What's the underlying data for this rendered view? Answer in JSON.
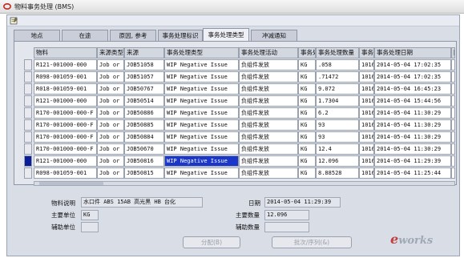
{
  "window": {
    "title": "物料事务处理 (BMS)"
  },
  "tabs": [
    {
      "label": "地点",
      "active": false
    },
    {
      "label": "在途",
      "active": false
    },
    {
      "label": "原因, 参考",
      "active": false
    },
    {
      "label": "事务处理标识",
      "active": false
    },
    {
      "label": "事务处理类型",
      "active": true
    },
    {
      "label": "冲减通知",
      "active": false
    }
  ],
  "table": {
    "headers": [
      "物料",
      "来源类型",
      "来源",
      "事务处理类型",
      "事务处理活动",
      "事务处",
      "事务处理数量",
      "事务处",
      "事务处理日期",
      "["
    ],
    "rows": [
      [
        "R121-001000-000",
        "Job or",
        "JOB51058",
        "WIP Negative Issue",
        "负组件发放",
        "KG",
        ".058",
        "1016",
        "2014-05-04 17:02:35",
        ""
      ],
      [
        "R098-001059-001",
        "Job or",
        "JOB51057",
        "WIP Negative Issue",
        "负组件发放",
        "KG",
        ".71472",
        "1016",
        "2014-05-04 17:02:35",
        ""
      ],
      [
        "R018-001059-001",
        "Job or",
        "JOB50767",
        "WIP Negative Issue",
        "负组件发放",
        "KG",
        "9.072",
        "1016",
        "2014-05-04 16:45:23",
        ""
      ],
      [
        "R121-001000-000",
        "Job or",
        "JOB50514",
        "WIP Negative Issue",
        "负组件发放",
        "KG",
        "1.7304",
        "1016",
        "2014-05-04 15:44:56",
        ""
      ],
      [
        "R170-001000-000-F",
        "Job or",
        "JOB50886",
        "WIP Negative Issue",
        "负组件发放",
        "KG",
        "6.2",
        "1016",
        "2014-05-04 11:30:29",
        ""
      ],
      [
        "R170-001000-000-F",
        "Job or",
        "JOB50885",
        "WIP Negative Issue",
        "负组件发放",
        "KG",
        "93",
        "1016",
        "2014-05-04 11:30:29",
        ""
      ],
      [
        "R170-001000-000-F",
        "Job or",
        "JOB50884",
        "WIP Negative Issue",
        "负组件发放",
        "KG",
        "93",
        "1016",
        "2014-05-04 11:30:29",
        ""
      ],
      [
        "R170-001000-000-F",
        "Job or",
        "JOB50670",
        "WIP Negative Issue",
        "负组件发放",
        "KG",
        "12.4",
        "1016",
        "2014-05-04 11:30:29",
        ""
      ],
      [
        "R121-001000-000",
        "Job or",
        "JOB50816",
        "WIP Negative Issue",
        "负组件发放",
        "KG",
        "12.096",
        "1016",
        "2014-05-04 11:29:39",
        ""
      ],
      [
        "R098-001059-001",
        "Job or",
        "JOB50815",
        "WIP Negative Issue",
        "负组件发放",
        "KG",
        "8.88528",
        "1016",
        "2014-05-04 11:25:44",
        ""
      ]
    ],
    "selected_row": 8
  },
  "details": {
    "item_desc_label": "物料说明",
    "item_desc_value": "水口件 ABS 15AB 高光黑 HB 台化",
    "date_label": "日期",
    "date_value": "2014-05-04 11:29:39",
    "primary_uom_label": "主要单位",
    "primary_uom_value": "KG",
    "primary_qty_label": "主要数量",
    "primary_qty_value": "12.096",
    "secondary_uom_label": "辅助单位",
    "secondary_uom_value": "",
    "secondary_qty_label": "辅助数量",
    "secondary_qty_value": ""
  },
  "buttons": {
    "distribution": "分配(B)",
    "lot_serial": "批次/序列(&)"
  },
  "watermark": "eworks",
  "colors": {
    "selection": "#1a37c9",
    "current_row_marker": "#0b1e99",
    "panel": "#e3e6ed"
  }
}
